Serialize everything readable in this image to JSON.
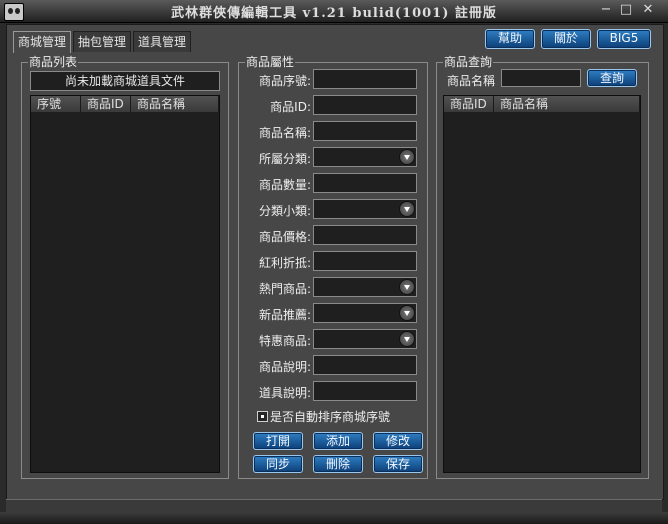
{
  "window": {
    "title": "武林群俠傳編輯工具 v1.21 bulid(1001) 註冊版",
    "minimize_glyph": "−",
    "maximize_glyph": "□",
    "close_glyph": "✕"
  },
  "tabs": [
    {
      "label": "商城管理",
      "active": true
    },
    {
      "label": "抽包管理",
      "active": false
    },
    {
      "label": "道具管理",
      "active": false
    }
  ],
  "top_buttons": {
    "help": "幫助",
    "about": "關於",
    "big5": "BIG5"
  },
  "product_list": {
    "group_label": "商品列表",
    "file_status": "尚未加載商城道具文件",
    "columns": [
      "序號",
      "商品ID",
      "商品名稱"
    ]
  },
  "product_attributes": {
    "group_label": "商品屬性",
    "fields": [
      {
        "label": "商品序號:",
        "dropdown": false
      },
      {
        "label": "商品ID:",
        "dropdown": false
      },
      {
        "label": "商品名稱:",
        "dropdown": false
      },
      {
        "label": "所屬分類:",
        "dropdown": true
      },
      {
        "label": "商品數量:",
        "dropdown": false
      },
      {
        "label": "分類小類:",
        "dropdown": true
      },
      {
        "label": "商品價格:",
        "dropdown": false
      },
      {
        "label": "紅利折抵:",
        "dropdown": false
      },
      {
        "label": "熱門商品:",
        "dropdown": true
      },
      {
        "label": "新品推薦:",
        "dropdown": true
      },
      {
        "label": "特惠商品:",
        "dropdown": true
      },
      {
        "label": "商品說明:",
        "dropdown": false
      },
      {
        "label": "道具說明:",
        "dropdown": false
      }
    ],
    "auto_sort_label": "是否自動排序商城序號",
    "buttons": {
      "open": "打開",
      "add": "添加",
      "modify": "修改",
      "sync": "同步",
      "delete": "刪除",
      "save": "保存"
    }
  },
  "product_query": {
    "group_label": "商品查詢",
    "name_label": "商品名稱",
    "query_button": "查詢",
    "columns": [
      "商品ID",
      "商品名稱"
    ]
  },
  "colors": {
    "accent_button": "#1f5fa0",
    "panel": "#474747",
    "dark_field": "#1f1f1f"
  }
}
